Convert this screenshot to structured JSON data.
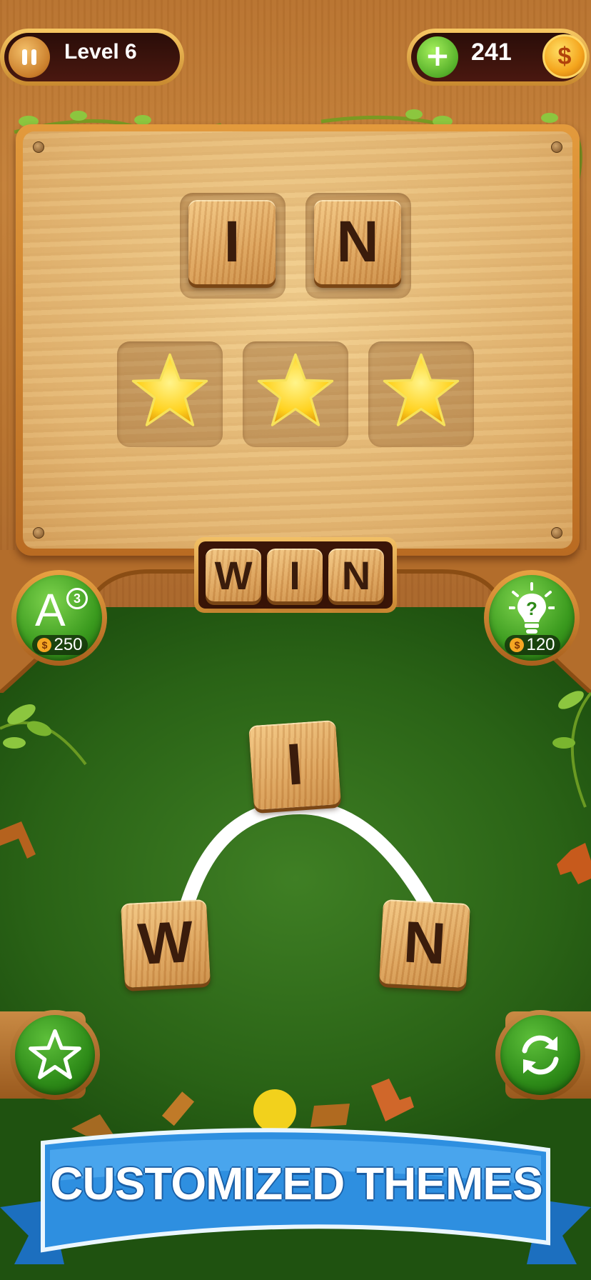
{
  "top_bar": {
    "level_label": "Level 6",
    "coins": "241",
    "coin_symbol": "$"
  },
  "board": {
    "found_tiles": [
      "I",
      "N"
    ],
    "star_slots": 3
  },
  "answer_strip": {
    "letters": [
      "W",
      "I",
      "N"
    ]
  },
  "powerups": {
    "letter_reveal": {
      "icon": "letter-a-icon",
      "glyph": "A",
      "count": "3",
      "price": "250"
    },
    "hint": {
      "icon": "lightbulb-icon",
      "price": "120"
    }
  },
  "wheel": {
    "letters": [
      "I",
      "W",
      "N"
    ]
  },
  "controls": {
    "favorite_icon": "star-icon",
    "shuffle_icon": "shuffle-icon"
  },
  "banner": {
    "text": "CUSTOMIZED THEMES"
  },
  "colors": {
    "wood": "#c58139",
    "felt_green": "#2e6a1c",
    "banner_blue": "#2e8fe0",
    "star_yellow": "#ffd21f"
  }
}
